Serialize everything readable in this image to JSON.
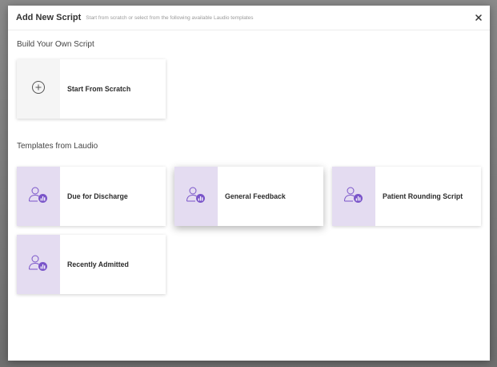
{
  "modal": {
    "title": "Add New Script",
    "subtitle": "Start from scratch or select from the following available Laudio templates",
    "close_icon": "close-icon"
  },
  "build_section": {
    "title": "Build Your Own Script",
    "card": {
      "label": "Start From Scratch",
      "icon": "plus-circle-icon"
    }
  },
  "templates_section": {
    "title": "Templates from Laudio",
    "cards": [
      {
        "label": "Due for Discharge",
        "icon": "person-chart-icon"
      },
      {
        "label": "General Feedback",
        "icon": "person-chart-icon"
      },
      {
        "label": "Patient Rounding Script",
        "icon": "person-chart-icon"
      },
      {
        "label": "Recently Admitted",
        "icon": "person-chart-icon"
      }
    ]
  },
  "colors": {
    "template_icon_bg": "#e4dcf1",
    "icon_accent": "#7a55c9",
    "scratch_icon_bg": "#f5f5f5"
  }
}
